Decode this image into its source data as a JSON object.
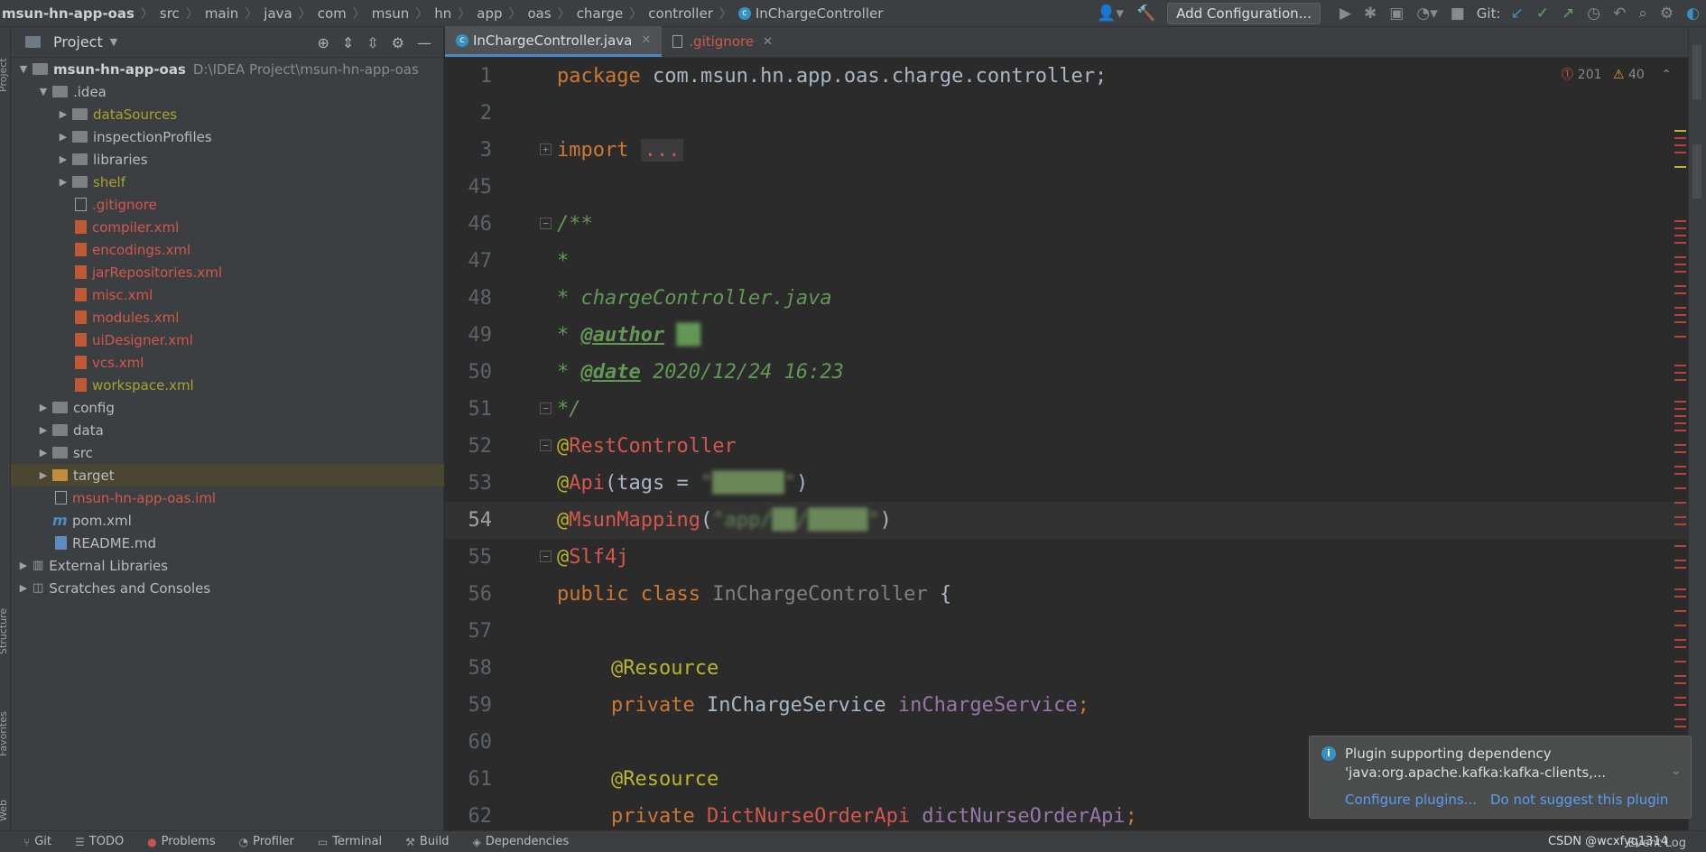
{
  "breadcrumb": [
    "msun-hn-app-oas",
    "src",
    "main",
    "java",
    "com",
    "msun",
    "hn",
    "app",
    "oas",
    "charge",
    "controller",
    "InChargeController"
  ],
  "toolbar": {
    "add_config_label": "Add Configuration...",
    "git_label": "Git:"
  },
  "left_stripe": [
    "Project",
    "Structure",
    "Favorites",
    "Web"
  ],
  "project_panel": {
    "title": "Project",
    "root_name": "msun-hn-app-oas",
    "root_path": "D:\\IDEA Project\\msun-hn-app-oas",
    "items": [
      {
        "label": ".idea"
      },
      {
        "label": "dataSources"
      },
      {
        "label": "inspectionProfiles"
      },
      {
        "label": "libraries"
      },
      {
        "label": "shelf"
      },
      {
        "label": ".gitignore"
      },
      {
        "label": "compiler.xml"
      },
      {
        "label": "encodings.xml"
      },
      {
        "label": "jarRepositories.xml"
      },
      {
        "label": "misc.xml"
      },
      {
        "label": "modules.xml"
      },
      {
        "label": "uiDesigner.xml"
      },
      {
        "label": "vcs.xml"
      },
      {
        "label": "workspace.xml"
      },
      {
        "label": "config"
      },
      {
        "label": "data"
      },
      {
        "label": "src"
      },
      {
        "label": "target"
      },
      {
        "label": "msun-hn-app-oas.iml"
      },
      {
        "label": "pom.xml"
      },
      {
        "label": "README.md"
      },
      {
        "label": "External Libraries"
      },
      {
        "label": "Scratches and Consoles"
      }
    ]
  },
  "editor": {
    "tabs": [
      {
        "label": "InChargeController.java"
      },
      {
        "label": ".gitignore"
      }
    ],
    "inspections": {
      "errors": "201",
      "warnings": "40"
    },
    "line_numbers": [
      "1",
      "2",
      "3",
      "45",
      "46",
      "47",
      "48",
      "49",
      "50",
      "51",
      "52",
      "53",
      "54",
      "55",
      "56",
      "57",
      "58",
      "59",
      "60",
      "61",
      "62"
    ],
    "code": {
      "l1_kw": "package",
      "l1_rest": " com.msun.hn.app.oas.charge.controller;",
      "l3_kw": "import",
      "l3_fold": "...",
      "l46": "/**",
      "l47": "*",
      "l48": "* chargeController.java",
      "l49_star": "* ",
      "l49_tag": "@author",
      "l49_val": " ██",
      "l50_star": "* ",
      "l50_tag": "@date",
      "l50_val": " 2020/12/24 16:23",
      "l51": "*/",
      "l52_at": "@",
      "l52_name": "RestController",
      "l53_at": "@",
      "l53_name": "Api",
      "l53_open": "(tags = ",
      "l53_val": "\"██████\"",
      "l53_close": ")",
      "l54_at": "@",
      "l54_name": "MsunMapping",
      "l54_open": "(",
      "l54_val": "\"app/██/█████\"",
      "l54_close": ")",
      "l55_at": "@",
      "l55_name": "Slf4j",
      "l56_kw": "public class",
      "l56_name": " InChargeController",
      "l56_rest": " {",
      "l58": "@Resource",
      "l59_kw": "private",
      "l59_type": " InChargeService",
      "l59_field": " inChargeService",
      "l59_end": ";",
      "l61": "@Resource",
      "l62_kw": "private",
      "l62_type": " DictNurseOrderApi",
      "l62_field": " dictNurseOrderApi",
      "l62_end": ";"
    }
  },
  "notification": {
    "title": "Plugin supporting dependency",
    "body": "'java:org.apache.kafka:kafka-clients,...",
    "link_configure": "Configure plugins...",
    "link_dismiss": "Do not suggest this plugin"
  },
  "bottom_bar": {
    "items": [
      "Git",
      "TODO",
      "Problems",
      "Profiler",
      "Terminal",
      "Build",
      "Dependencies"
    ],
    "watermark": "CSDN @wcxfyq1314",
    "event_log": "Event Log"
  }
}
